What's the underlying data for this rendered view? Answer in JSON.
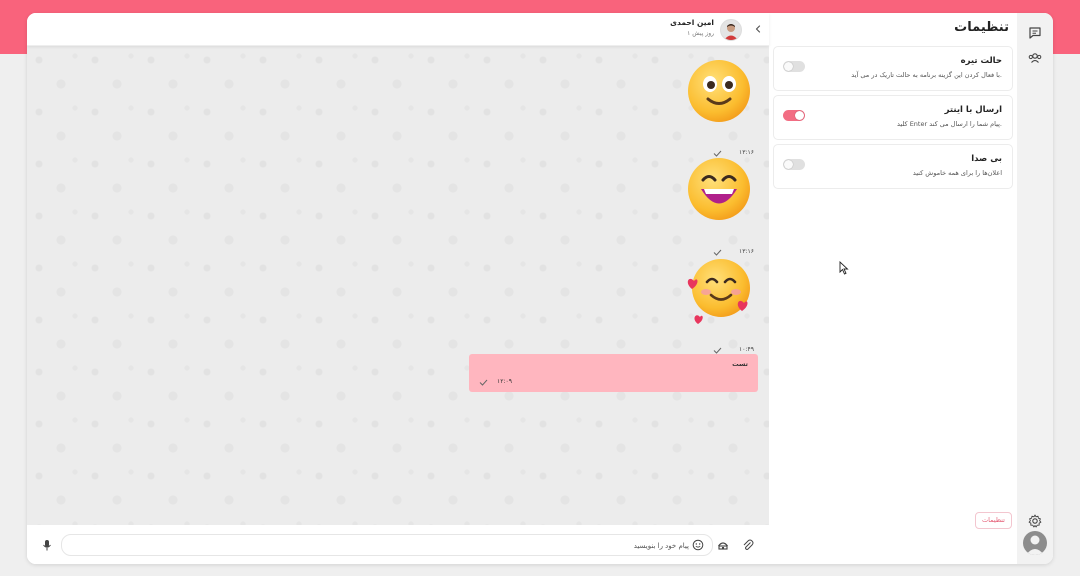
{
  "colors": {
    "accent": "#f9637c",
    "bubble": "#ffb6bf",
    "toggle_on": "#f26d83"
  },
  "settings": {
    "title": "تنظیمات",
    "items": [
      {
        "title": "حالت تیره",
        "desc": "با فعال کردن این گزینه برنامه به حالت تاریک در می آید.",
        "enabled": false
      },
      {
        "title": "ارسال با اینتر",
        "desc": "کلید Enter پیام شما را ارسال می کند.",
        "enabled": true
      },
      {
        "title": "بی صدا",
        "desc": "اعلان‌ها را برای همه خاموش کنید",
        "enabled": false
      }
    ],
    "chip_label": "تنظیمات"
  },
  "rail": {
    "icons": [
      "chat-icon",
      "users-icon",
      "gear-icon",
      "profile-avatar"
    ]
  },
  "chat": {
    "contact_name": "امین احمدی",
    "contact_status": "۱ روز پیش",
    "messages": [
      {
        "type": "sticker",
        "emoji": "smiling-face-icon",
        "time": "۱۳:۱۶",
        "status": "sent"
      },
      {
        "type": "sticker",
        "emoji": "grinning-face-icon",
        "time": "۱۳:۱۶",
        "status": "sent"
      },
      {
        "type": "sticker",
        "emoji": "smiling-hearts-icon",
        "time": "۱۰:۴۹",
        "status": "sent"
      },
      {
        "type": "text",
        "text": "تست",
        "time": "۱۲:۰۹",
        "status": "sent"
      }
    ]
  },
  "composer": {
    "placeholder": "پیام خود را بنویسید"
  }
}
